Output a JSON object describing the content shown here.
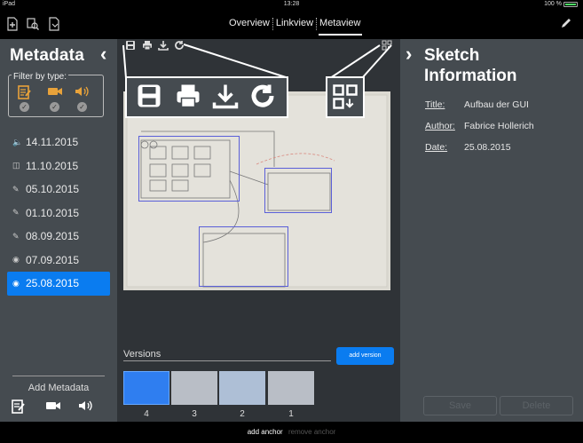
{
  "status": {
    "device": "iPad",
    "time": "13:28",
    "battery": "100 %"
  },
  "toolbar": {
    "icons": [
      "add-document-icon",
      "search-document-icon",
      "document-icon"
    ],
    "edit_icon": "pencil-icon"
  },
  "tabs": [
    {
      "label": "Overview",
      "active": false
    },
    {
      "label": "Linkview",
      "active": false
    },
    {
      "label": "Metaview",
      "active": true
    }
  ],
  "left_panel": {
    "title": "Metadata",
    "filter_label": "Filter by type:",
    "filter_types": [
      "note",
      "video",
      "audio"
    ],
    "dates": [
      {
        "icon": "audio-icon",
        "label": "14.11.2015",
        "selected": false
      },
      {
        "icon": "video-icon",
        "label": "11.10.2015",
        "selected": false
      },
      {
        "icon": "note-icon",
        "label": "05.10.2015",
        "selected": false
      },
      {
        "icon": "note-icon",
        "label": "01.10.2015",
        "selected": false
      },
      {
        "icon": "note-icon",
        "label": "08.09.2015",
        "selected": false
      },
      {
        "icon": "camera-icon",
        "label": "07.09.2015",
        "selected": false
      },
      {
        "icon": "camera-icon",
        "label": "25.08.2015",
        "selected": true
      }
    ],
    "add_metadata_label": "Add Metadata"
  },
  "center": {
    "versions_label": "Versions",
    "add_version_label": "add version",
    "thumbnails": [
      "4",
      "3",
      "2",
      "1"
    ]
  },
  "right_panel": {
    "title": "Sketch Information",
    "title_line1": "Sketch",
    "title_line2": "Information",
    "fields": [
      {
        "key": "Title:",
        "value": "Aufbau der GUI"
      },
      {
        "key": "Author:",
        "value": "Fabrice Hollerich"
      },
      {
        "key": "Date:",
        "value": "25.08.2015"
      }
    ],
    "save_label": "Save",
    "delete_label": "Delete"
  },
  "bottom": {
    "add_anchor": "add anchor",
    "remove_anchor": "remove anchor"
  },
  "colors": {
    "accent": "#0a7cf0",
    "panel": "#454b50",
    "filter_icon": "#e8a23a"
  }
}
